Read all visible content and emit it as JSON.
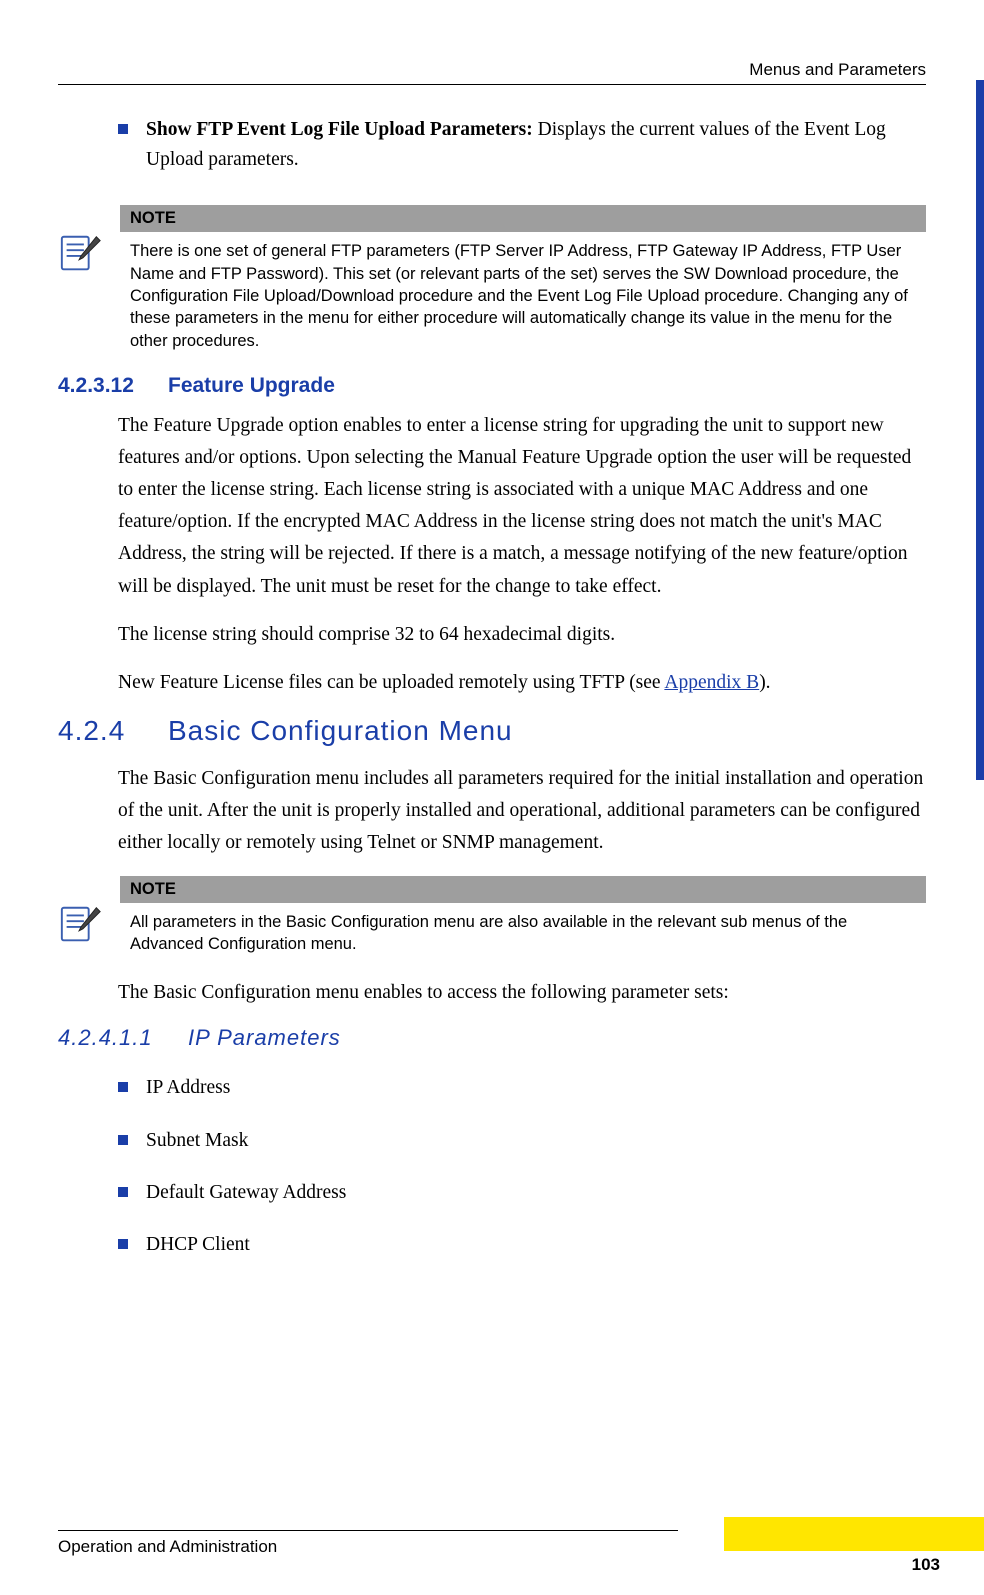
{
  "header": {
    "running": "Menus and Parameters"
  },
  "top_bullet": {
    "lead": "Show FTP Event Log File Upload Parameters:",
    "rest": " Displays the current values of the Event Log Upload parameters."
  },
  "note1": {
    "label": "NOTE",
    "text": "There is one set of general FTP parameters (FTP Server IP Address, FTP Gateway IP Address, FTP User Name and FTP Password). This set (or relevant parts of the set) serves the SW Download procedure, the Configuration File Upload/Download procedure and the Event Log File Upload procedure. Changing any of these parameters in the menu for either procedure will automatically change its value in the menu for the other procedures."
  },
  "sec1": {
    "num": "4.2.3.12",
    "title": "Feature Upgrade",
    "p1": "The Feature Upgrade option enables to enter a license string for upgrading the unit to support new features and/or options. Upon selecting the Manual Feature Upgrade option the user will be requested to enter the license string. Each license string is associated with a unique MAC Address and one feature/option. If the encrypted MAC Address in the license string does not match the unit's MAC Address, the string will be rejected. If there is a match, a message notifying of the new feature/option will be displayed. The unit must be reset for the change to take effect.",
    "p2": "The license string should comprise 32 to 64 hexadecimal digits.",
    "p3a": "New Feature License files can be uploaded remotely using TFTP (see ",
    "p3link": "Appendix B",
    "p3b": ")."
  },
  "sec2": {
    "num": "4.2.4",
    "title": "Basic Configuration Menu",
    "p1": "The Basic Configuration menu includes all parameters required for the initial installation and operation of the unit. After the unit is properly installed and operational, additional parameters can be configured either locally or remotely using Telnet or SNMP management."
  },
  "note2": {
    "label": "NOTE",
    "text": "All parameters in the Basic Configuration menu are also available in the relevant sub menus of the Advanced Configuration menu."
  },
  "after_note2": "The Basic Configuration menu enables to access the following parameter sets:",
  "sec3": {
    "num": "4.2.4.1.1",
    "title": "IP Parameters",
    "items": [
      "IP Address",
      "Subnet Mask",
      "Default Gateway Address",
      "DHCP Client"
    ]
  },
  "footer": {
    "left": "Operation and Administration",
    "page": "103"
  }
}
